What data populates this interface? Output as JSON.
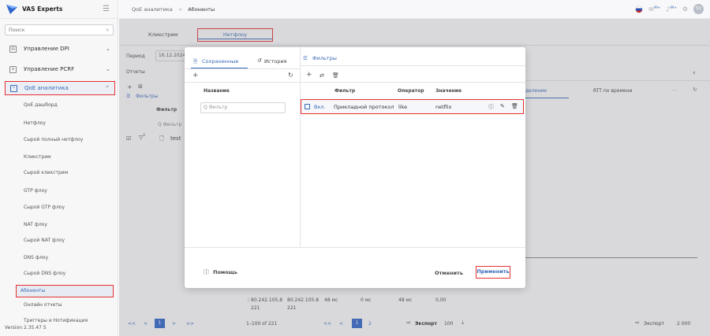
{
  "app": {
    "brand": "VAS Experts",
    "version": "Version 2.35.47 S"
  },
  "search": {
    "placeholder": "Поиск",
    "clear": "×"
  },
  "sidebar": {
    "groups": [
      "Управление DPI",
      "Управление PCRF",
      "QoE аналитика"
    ],
    "items": [
      "QoE дашборд",
      "Нетфлоу",
      "Сырой полный нетфлоу",
      "Кликстрим",
      "Сырой кликстрим",
      "GTP флоу",
      "Сырой GTP флоу",
      "NAT флоу",
      "Сырой NAT флоу",
      "DNS флоу",
      "Сырой DNS флоу",
      "Абоненты",
      "Онлайн отчеты",
      "Триггеры и Нотификация"
    ]
  },
  "header": {
    "crumb1": "QoE аналитика",
    "sep": ">",
    "crumb2": "Абоненты",
    "badge1": "99+",
    "badge2": "99+"
  },
  "avatar": "SV",
  "main": {
    "tabs": [
      "Кликстрим",
      "Нетфлоу"
    ],
    "period_label": "Период",
    "period_value": "16.12.2024",
    "reports_label": "Отчеты",
    "filters_label": "Фильтры",
    "filter_col": "Фильтр",
    "filter_ph": "Q Фильтр",
    "row_name": "test",
    "row_sup": "1",
    "right_tabs": [
      "деление",
      "RTT по времени",
      "..."
    ],
    "bottom_rows": [
      [
        "80.242.105.8",
        "80.242.105.8",
        "48 мс",
        "0 мс",
        "48 мс",
        "0,00"
      ],
      [
        "221",
        "221"
      ]
    ],
    "pag_range": "1–100 of 221",
    "pag_page1": "1",
    "pag_page2": "2",
    "export": "Экспорт",
    "per_page": "100",
    "export2": "Экспорт",
    "total": "2 000"
  },
  "modal": {
    "tab_saved": "Сохраненные",
    "tab_history": "История",
    "filters_title": "Фильтры",
    "name_col": "Название",
    "name_ph": "Q Фильтр",
    "cols": [
      "Фильтр",
      "Оператор",
      "Значение"
    ],
    "row": {
      "enabled": "Вкл.",
      "filter": "Прикладной протокол",
      "operator": "like",
      "value": "netflix"
    },
    "help": "Помощь",
    "cancel": "Отменить",
    "apply": "Применить"
  }
}
